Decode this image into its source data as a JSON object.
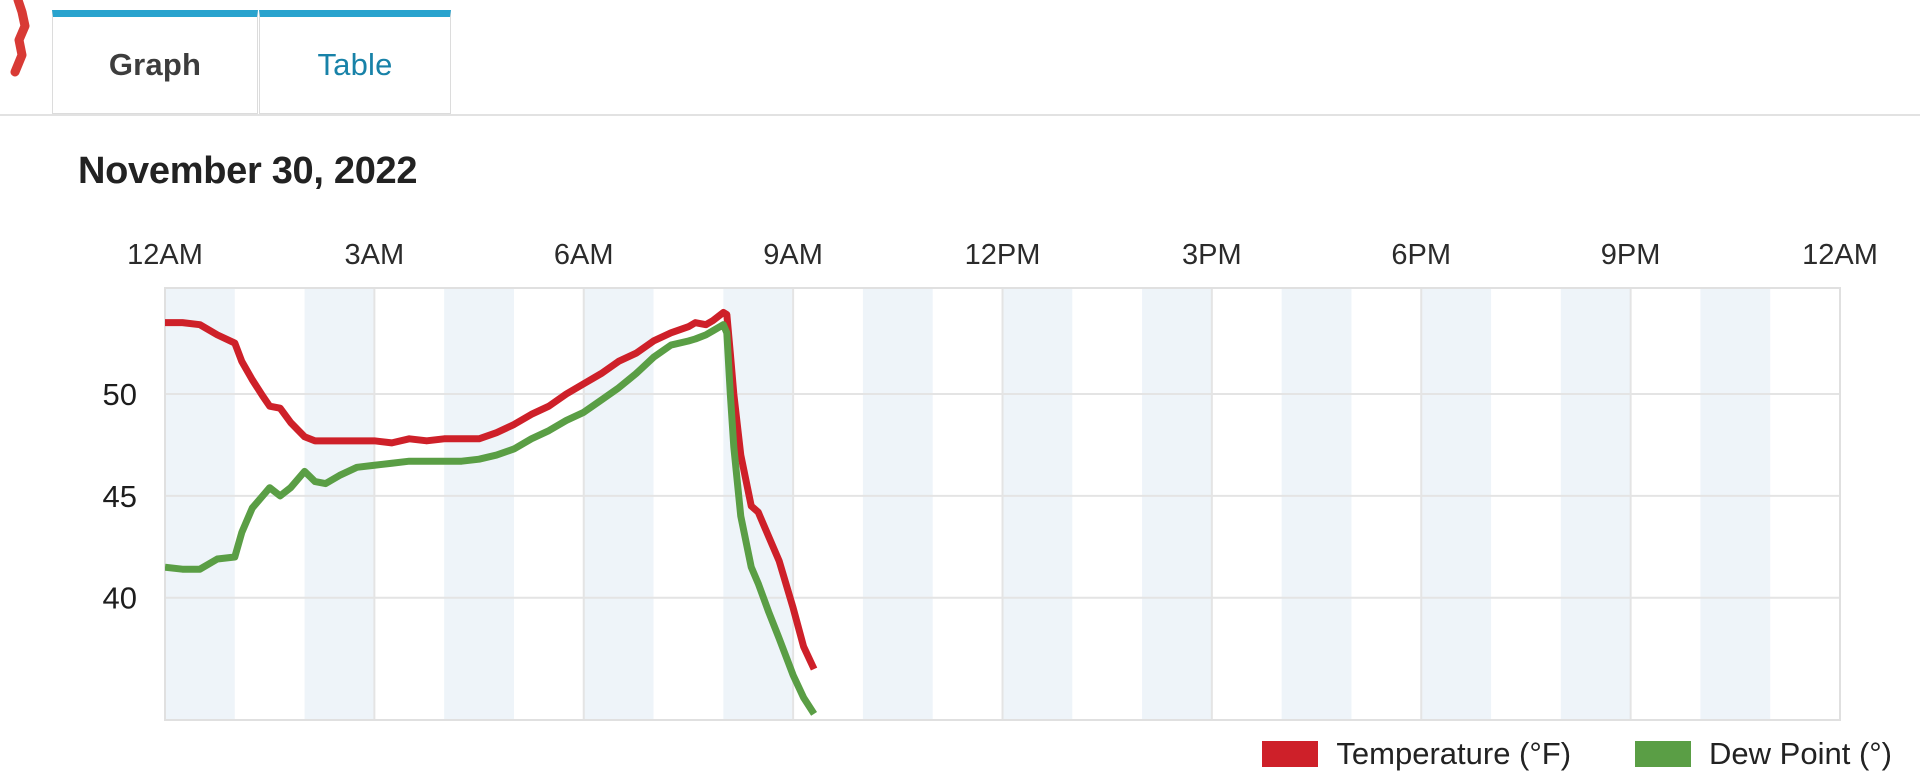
{
  "tabs": [
    {
      "label": "Graph",
      "active": true,
      "name": "tab-graph"
    },
    {
      "label": "Table",
      "active": false,
      "name": "tab-table"
    }
  ],
  "page_title": "November 30, 2022",
  "colors": {
    "temperature": "#ce2029",
    "dew_point": "#5a9e45",
    "tab_accent": "#29a3ce",
    "tab_link": "#1882a8",
    "band": "#eef4f9",
    "grid": "#e4e4e4",
    "plot_border": "#e0e0e0"
  },
  "legend": [
    {
      "label": "Temperature (°F)",
      "color": "#ce2029",
      "name": "legend-temperature"
    },
    {
      "label": "Dew Point (°)",
      "color": "#5a9e45",
      "name": "legend-dew-point"
    }
  ],
  "chart_data": {
    "type": "line",
    "title": "November 30, 2022",
    "xlabel": "",
    "ylabel": "",
    "grid": true,
    "legend_position": "bottom-right",
    "xlim": [
      0,
      24
    ],
    "ylim": [
      34.0,
      55.2
    ],
    "xtick_labels": [
      "12AM",
      "3AM",
      "6AM",
      "9AM",
      "12PM",
      "3PM",
      "6PM",
      "9PM",
      "12AM"
    ],
    "xtick_hours": [
      0,
      3,
      6,
      9,
      12,
      15,
      18,
      21,
      24
    ],
    "ytick_labels": [
      "40",
      "45",
      "50"
    ],
    "ytick_values": [
      40,
      45,
      50
    ],
    "band_interval_hours": 1,
    "x": [
      0.0,
      0.25,
      0.5,
      0.75,
      1.0,
      1.1,
      1.25,
      1.4,
      1.5,
      1.65,
      1.8,
      2.0,
      2.15,
      2.3,
      2.5,
      2.75,
      3.0,
      3.25,
      3.5,
      3.75,
      4.0,
      4.25,
      4.5,
      4.75,
      5.0,
      5.25,
      5.5,
      5.75,
      6.0,
      6.25,
      6.5,
      6.75,
      7.0,
      7.25,
      7.5,
      7.6,
      7.75,
      7.85,
      8.0,
      8.05,
      8.1,
      8.15,
      8.25,
      8.4,
      8.5,
      8.65,
      8.8,
      9.0,
      9.15,
      9.3
    ],
    "series": [
      {
        "name": "Temperature (°F)",
        "color": "#ce2029",
        "unit": "°F",
        "values": [
          53.5,
          53.5,
          53.4,
          52.9,
          52.5,
          51.6,
          50.7,
          49.9,
          49.4,
          49.3,
          48.6,
          47.9,
          47.7,
          47.7,
          47.7,
          47.7,
          47.7,
          47.6,
          47.8,
          47.7,
          47.8,
          47.8,
          47.8,
          48.1,
          48.5,
          49.0,
          49.4,
          50.0,
          50.5,
          51.0,
          51.6,
          52.0,
          52.6,
          53.0,
          53.3,
          53.5,
          53.4,
          53.6,
          54.0,
          53.9,
          52.0,
          50.0,
          47.0,
          44.5,
          44.2,
          43.0,
          41.8,
          39.5,
          37.6,
          36.5
        ]
      },
      {
        "name": "Dew Point (°)",
        "color": "#5a9e45",
        "unit": "°",
        "values": [
          41.5,
          41.4,
          41.4,
          41.9,
          42.0,
          43.2,
          44.4,
          45.0,
          45.4,
          45.0,
          45.4,
          46.2,
          45.7,
          45.6,
          46.0,
          46.4,
          46.5,
          46.6,
          46.7,
          46.7,
          46.7,
          46.7,
          46.8,
          47.0,
          47.3,
          47.8,
          48.2,
          48.7,
          49.1,
          49.7,
          50.3,
          51.0,
          51.8,
          52.4,
          52.6,
          52.7,
          52.9,
          53.1,
          53.4,
          53.0,
          50.0,
          47.4,
          44.0,
          41.5,
          40.7,
          39.3,
          38.0,
          36.2,
          35.1,
          34.3
        ]
      }
    ]
  }
}
